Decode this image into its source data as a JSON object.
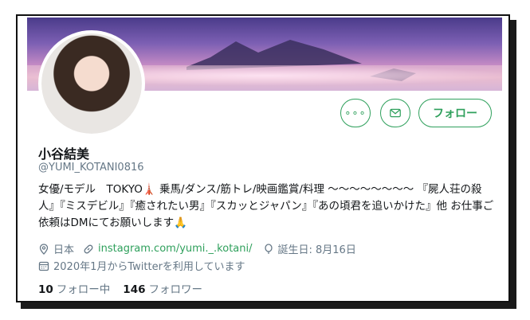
{
  "profile": {
    "display_name": "小谷結美",
    "handle": "@YUMI_KOTANI0816",
    "bio": "女優/モデル　TOKYO🗼 乗馬/ダンス/筋トレ/映画鑑賞/料理 〜〜〜〜〜〜〜〜 『屍人荘の殺人』『ミスデビル』『癒されたい男』『スカッとジャパン』『あの頃君を追いかけた』他 お仕事ご依頼はDMにてお願いします🙏",
    "location": "日本",
    "website": "instagram.com/yumi._.kotani/",
    "birthday": "誕生日: 8月16日",
    "joined": "2020年1月からTwitterを利用しています"
  },
  "actions": {
    "more_label": "∘∘∘",
    "follow_label": "フォロー"
  },
  "stats": {
    "following_count": "10",
    "following_label": "フォロー中",
    "followers_count": "146",
    "followers_label": "フォロワー"
  },
  "colors": {
    "accent": "#2fa05c",
    "muted": "#657786",
    "text": "#14171a"
  }
}
